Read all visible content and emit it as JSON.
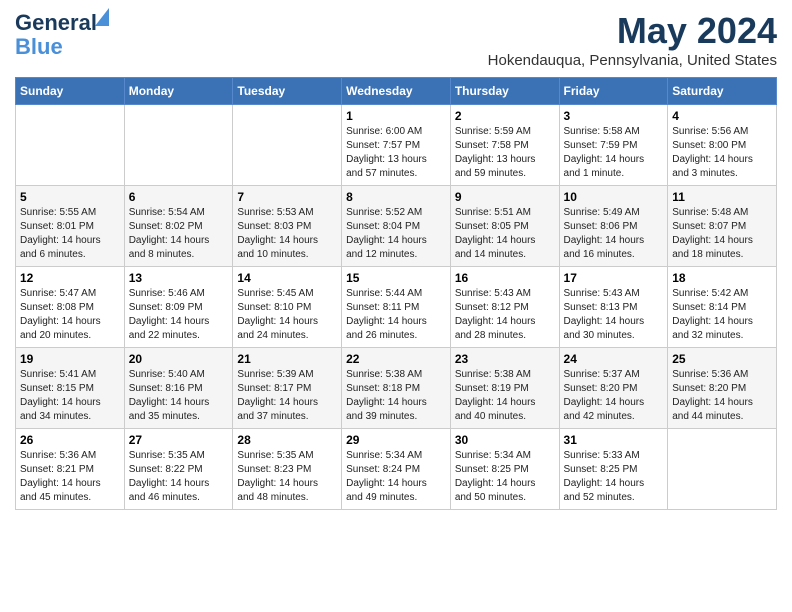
{
  "logo": {
    "line1": "General",
    "line2": "Blue"
  },
  "title": "May 2024",
  "subtitle": "Hokendauqua, Pennsylvania, United States",
  "days_of_week": [
    "Sunday",
    "Monday",
    "Tuesday",
    "Wednesday",
    "Thursday",
    "Friday",
    "Saturday"
  ],
  "weeks": [
    [
      {
        "num": "",
        "info": ""
      },
      {
        "num": "",
        "info": ""
      },
      {
        "num": "",
        "info": ""
      },
      {
        "num": "1",
        "info": "Sunrise: 6:00 AM\nSunset: 7:57 PM\nDaylight: 13 hours\nand 57 minutes."
      },
      {
        "num": "2",
        "info": "Sunrise: 5:59 AM\nSunset: 7:58 PM\nDaylight: 13 hours\nand 59 minutes."
      },
      {
        "num": "3",
        "info": "Sunrise: 5:58 AM\nSunset: 7:59 PM\nDaylight: 14 hours\nand 1 minute."
      },
      {
        "num": "4",
        "info": "Sunrise: 5:56 AM\nSunset: 8:00 PM\nDaylight: 14 hours\nand 3 minutes."
      }
    ],
    [
      {
        "num": "5",
        "info": "Sunrise: 5:55 AM\nSunset: 8:01 PM\nDaylight: 14 hours\nand 6 minutes."
      },
      {
        "num": "6",
        "info": "Sunrise: 5:54 AM\nSunset: 8:02 PM\nDaylight: 14 hours\nand 8 minutes."
      },
      {
        "num": "7",
        "info": "Sunrise: 5:53 AM\nSunset: 8:03 PM\nDaylight: 14 hours\nand 10 minutes."
      },
      {
        "num": "8",
        "info": "Sunrise: 5:52 AM\nSunset: 8:04 PM\nDaylight: 14 hours\nand 12 minutes."
      },
      {
        "num": "9",
        "info": "Sunrise: 5:51 AM\nSunset: 8:05 PM\nDaylight: 14 hours\nand 14 minutes."
      },
      {
        "num": "10",
        "info": "Sunrise: 5:49 AM\nSunset: 8:06 PM\nDaylight: 14 hours\nand 16 minutes."
      },
      {
        "num": "11",
        "info": "Sunrise: 5:48 AM\nSunset: 8:07 PM\nDaylight: 14 hours\nand 18 minutes."
      }
    ],
    [
      {
        "num": "12",
        "info": "Sunrise: 5:47 AM\nSunset: 8:08 PM\nDaylight: 14 hours\nand 20 minutes."
      },
      {
        "num": "13",
        "info": "Sunrise: 5:46 AM\nSunset: 8:09 PM\nDaylight: 14 hours\nand 22 minutes."
      },
      {
        "num": "14",
        "info": "Sunrise: 5:45 AM\nSunset: 8:10 PM\nDaylight: 14 hours\nand 24 minutes."
      },
      {
        "num": "15",
        "info": "Sunrise: 5:44 AM\nSunset: 8:11 PM\nDaylight: 14 hours\nand 26 minutes."
      },
      {
        "num": "16",
        "info": "Sunrise: 5:43 AM\nSunset: 8:12 PM\nDaylight: 14 hours\nand 28 minutes."
      },
      {
        "num": "17",
        "info": "Sunrise: 5:43 AM\nSunset: 8:13 PM\nDaylight: 14 hours\nand 30 minutes."
      },
      {
        "num": "18",
        "info": "Sunrise: 5:42 AM\nSunset: 8:14 PM\nDaylight: 14 hours\nand 32 minutes."
      }
    ],
    [
      {
        "num": "19",
        "info": "Sunrise: 5:41 AM\nSunset: 8:15 PM\nDaylight: 14 hours\nand 34 minutes."
      },
      {
        "num": "20",
        "info": "Sunrise: 5:40 AM\nSunset: 8:16 PM\nDaylight: 14 hours\nand 35 minutes."
      },
      {
        "num": "21",
        "info": "Sunrise: 5:39 AM\nSunset: 8:17 PM\nDaylight: 14 hours\nand 37 minutes."
      },
      {
        "num": "22",
        "info": "Sunrise: 5:38 AM\nSunset: 8:18 PM\nDaylight: 14 hours\nand 39 minutes."
      },
      {
        "num": "23",
        "info": "Sunrise: 5:38 AM\nSunset: 8:19 PM\nDaylight: 14 hours\nand 40 minutes."
      },
      {
        "num": "24",
        "info": "Sunrise: 5:37 AM\nSunset: 8:20 PM\nDaylight: 14 hours\nand 42 minutes."
      },
      {
        "num": "25",
        "info": "Sunrise: 5:36 AM\nSunset: 8:20 PM\nDaylight: 14 hours\nand 44 minutes."
      }
    ],
    [
      {
        "num": "26",
        "info": "Sunrise: 5:36 AM\nSunset: 8:21 PM\nDaylight: 14 hours\nand 45 minutes."
      },
      {
        "num": "27",
        "info": "Sunrise: 5:35 AM\nSunset: 8:22 PM\nDaylight: 14 hours\nand 46 minutes."
      },
      {
        "num": "28",
        "info": "Sunrise: 5:35 AM\nSunset: 8:23 PM\nDaylight: 14 hours\nand 48 minutes."
      },
      {
        "num": "29",
        "info": "Sunrise: 5:34 AM\nSunset: 8:24 PM\nDaylight: 14 hours\nand 49 minutes."
      },
      {
        "num": "30",
        "info": "Sunrise: 5:34 AM\nSunset: 8:25 PM\nDaylight: 14 hours\nand 50 minutes."
      },
      {
        "num": "31",
        "info": "Sunrise: 5:33 AM\nSunset: 8:25 PM\nDaylight: 14 hours\nand 52 minutes."
      },
      {
        "num": "",
        "info": ""
      }
    ]
  ]
}
